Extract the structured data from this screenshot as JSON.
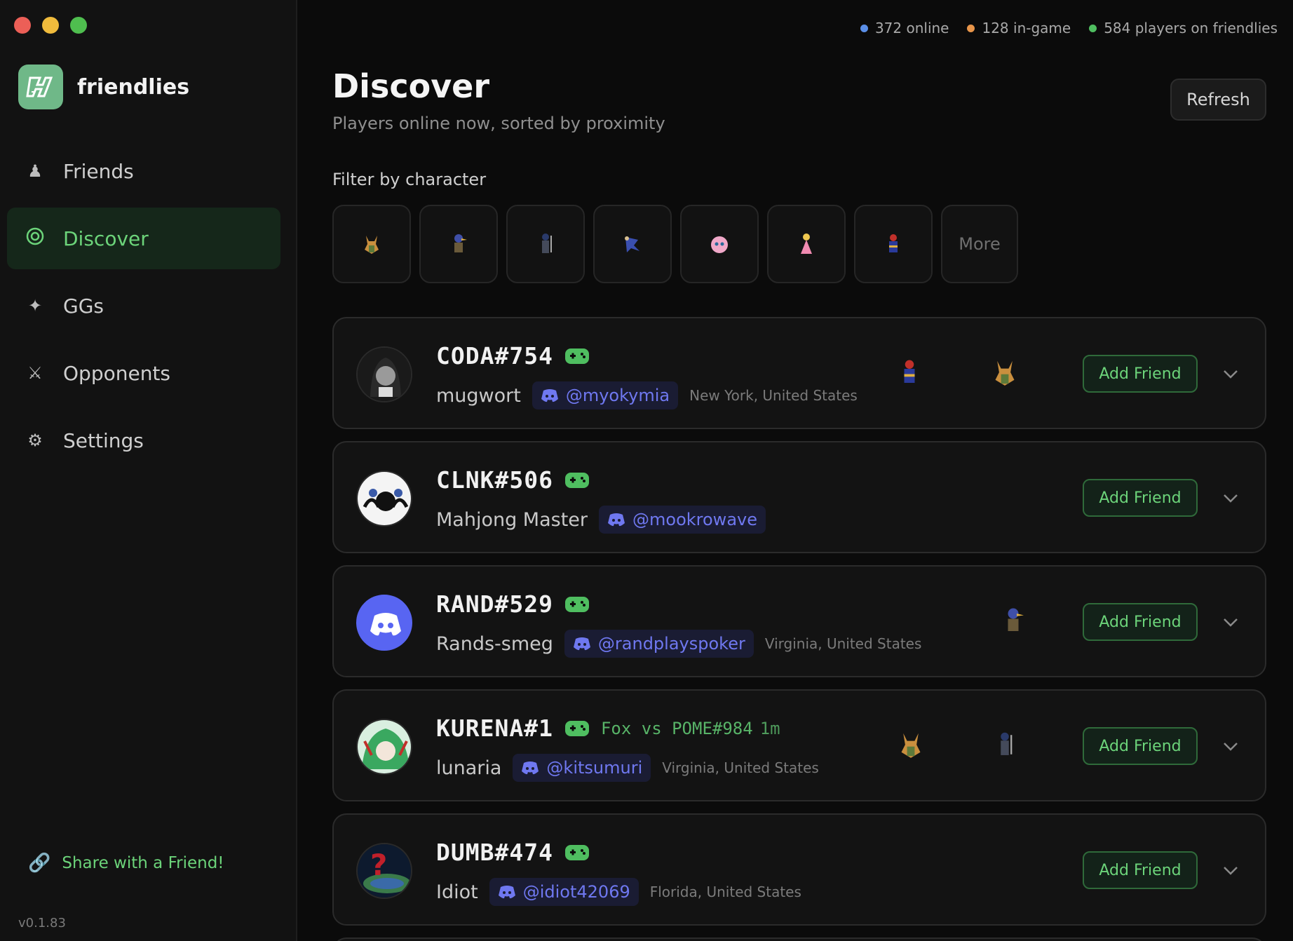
{
  "window": {
    "title": "friendlies"
  },
  "sidebar": {
    "brand": "friendlies",
    "items": [
      {
        "label": "Friends",
        "icon": "person-icon",
        "active": false
      },
      {
        "label": "Discover",
        "icon": "target-icon",
        "active": true
      },
      {
        "label": "GGs",
        "icon": "sparkle-icon",
        "active": false
      },
      {
        "label": "Opponents",
        "icon": "swords-icon",
        "active": false
      },
      {
        "label": "Settings",
        "icon": "gear-icon",
        "active": false
      }
    ],
    "share_label": "Share with a Friend!",
    "version": "v0.1.83"
  },
  "stats": {
    "online": "372 online",
    "in_game": "128 in-game",
    "players": "584 players on friendlies"
  },
  "colors": {
    "online": "#5b8fe8",
    "in_game": "#e8954a",
    "players": "#4fbe60",
    "accent": "#6cd47a"
  },
  "header": {
    "title": "Discover",
    "subtitle": "Players online now, sorted by proximity",
    "refresh_label": "Refresh"
  },
  "filter": {
    "label": "Filter by character",
    "characters": [
      "fox-icon",
      "falco-icon",
      "marth-icon",
      "sheik-icon",
      "jigglypuff-icon",
      "peach-icon",
      "captain-falcon-icon"
    ],
    "more_label": "More"
  },
  "players": [
    {
      "tag": "CODA#754",
      "display": "mugwort",
      "discord": "@myokymia",
      "location": "New York, United States",
      "activity": "",
      "time": "",
      "mains": [
        "captain-falcon-icon",
        "fox-icon"
      ],
      "add_label": "Add Friend"
    },
    {
      "tag": "CLNK#506",
      "display": "Mahjong Master",
      "discord": "@mookrowave",
      "location": "",
      "activity": "",
      "time": "",
      "mains": [],
      "add_label": "Add Friend"
    },
    {
      "tag": "RAND#529",
      "display": "Rands-smeg",
      "discord": "@randplayspoker",
      "location": "Virginia, United States",
      "activity": "",
      "time": "",
      "mains": [
        "falco-icon"
      ],
      "add_label": "Add Friend"
    },
    {
      "tag": "KURENA#1",
      "display": "lunaria",
      "discord": "@kitsumuri",
      "location": "Virginia, United States",
      "activity": "Fox vs POME#984",
      "time": "1m",
      "mains": [
        "fox-icon",
        "marth-icon"
      ],
      "add_label": "Add Friend"
    },
    {
      "tag": "DUMB#474",
      "display": "Idiot",
      "discord": "@idiot42069",
      "location": "Florida, United States",
      "activity": "",
      "time": "",
      "mains": [],
      "add_label": "Add Friend"
    }
  ]
}
